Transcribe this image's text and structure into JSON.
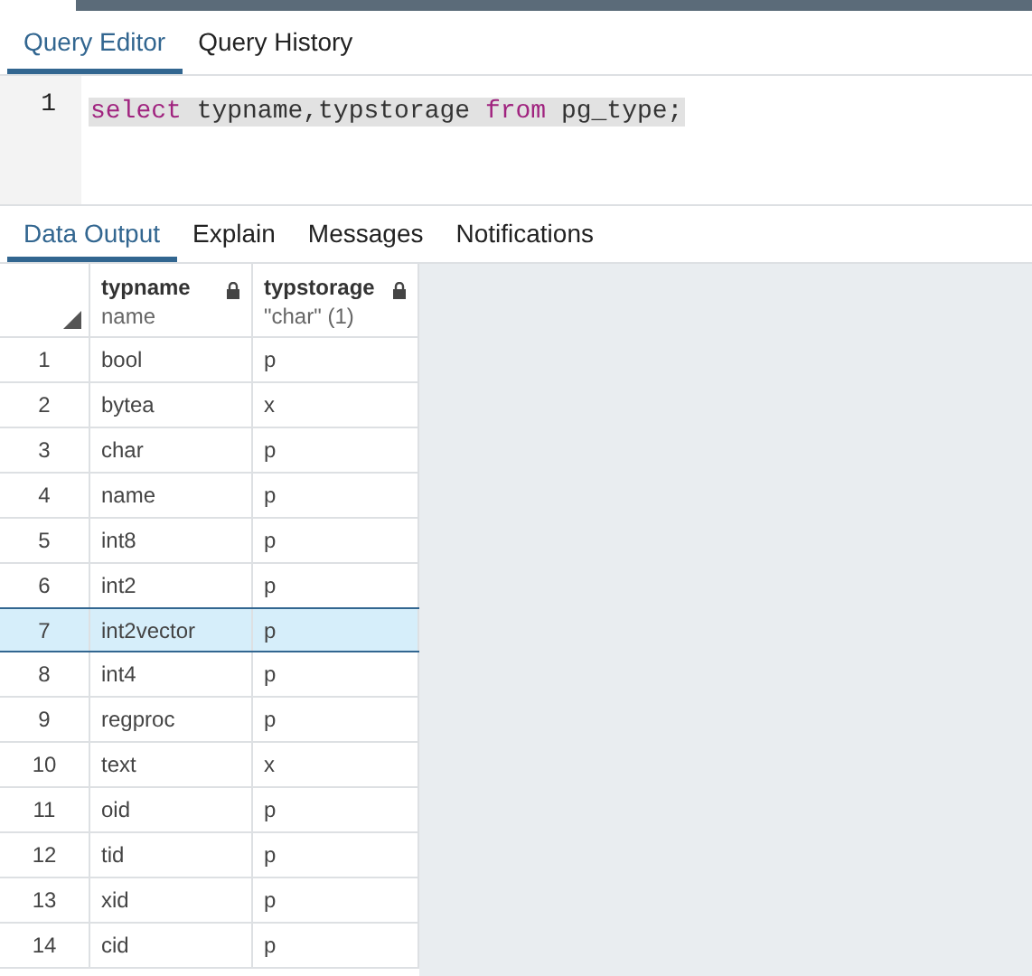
{
  "editor_tabs": [
    {
      "label": "Query Editor",
      "selected": true
    },
    {
      "label": "Query History",
      "selected": false
    }
  ],
  "editor": {
    "line_number": "1",
    "tokens": [
      {
        "text": "select",
        "kind": "keyword"
      },
      {
        "text": " typname,typstorage ",
        "kind": "plain"
      },
      {
        "text": "from",
        "kind": "keyword"
      },
      {
        "text": " pg_type;",
        "kind": "plain"
      }
    ]
  },
  "output_tabs": [
    {
      "label": "Data Output",
      "selected": true
    },
    {
      "label": "Explain",
      "selected": false
    },
    {
      "label": "Messages",
      "selected": false
    },
    {
      "label": "Notifications",
      "selected": false
    }
  ],
  "table": {
    "columns": [
      {
        "name": "typname",
        "type": "name"
      },
      {
        "name": "typstorage",
        "type": "\"char\" (1)"
      }
    ],
    "rows": [
      {
        "index": "1",
        "cells": [
          "bool",
          "p"
        ],
        "selected": false
      },
      {
        "index": "2",
        "cells": [
          "bytea",
          "x"
        ],
        "selected": false
      },
      {
        "index": "3",
        "cells": [
          "char",
          "p"
        ],
        "selected": false
      },
      {
        "index": "4",
        "cells": [
          "name",
          "p"
        ],
        "selected": false
      },
      {
        "index": "5",
        "cells": [
          "int8",
          "p"
        ],
        "selected": false
      },
      {
        "index": "6",
        "cells": [
          "int2",
          "p"
        ],
        "selected": false
      },
      {
        "index": "7",
        "cells": [
          "int2vector",
          "p"
        ],
        "selected": true
      },
      {
        "index": "8",
        "cells": [
          "int4",
          "p"
        ],
        "selected": false
      },
      {
        "index": "9",
        "cells": [
          "regproc",
          "p"
        ],
        "selected": false
      },
      {
        "index": "10",
        "cells": [
          "text",
          "x"
        ],
        "selected": false
      },
      {
        "index": "11",
        "cells": [
          "oid",
          "p"
        ],
        "selected": false
      },
      {
        "index": "12",
        "cells": [
          "tid",
          "p"
        ],
        "selected": false
      },
      {
        "index": "13",
        "cells": [
          "xid",
          "p"
        ],
        "selected": false
      },
      {
        "index": "14",
        "cells": [
          "cid",
          "p"
        ],
        "selected": false
      }
    ]
  }
}
